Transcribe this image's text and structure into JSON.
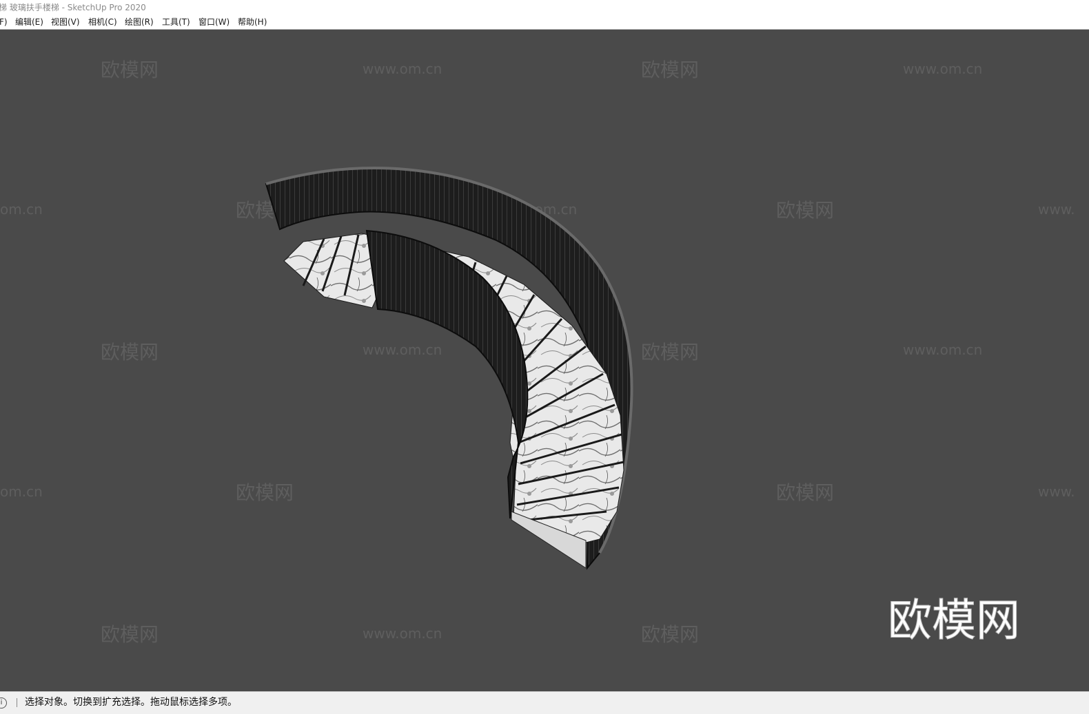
{
  "window": {
    "title": "梯 玻璃扶手楼梯 - SketchUp Pro 2020"
  },
  "menubar": {
    "items": [
      {
        "label": "F)"
      },
      {
        "label": "编辑(E)"
      },
      {
        "label": "视图(V)"
      },
      {
        "label": "相机(C)"
      },
      {
        "label": "绘图(R)"
      },
      {
        "label": "工具(T)"
      },
      {
        "label": "窗口(W)"
      },
      {
        "label": "帮助(H)"
      }
    ]
  },
  "viewport": {
    "watermark_logo": "欧模网",
    "watermark_url": "www.om.cn",
    "watermark_url_partial_left": "om.cn",
    "watermark_url_partial_right": "www.",
    "brand_logo": "欧模网"
  },
  "statusbar": {
    "icon": "info-icon",
    "text": "选择对象。切换到扩充选择。拖动鼠标选择多项。"
  }
}
